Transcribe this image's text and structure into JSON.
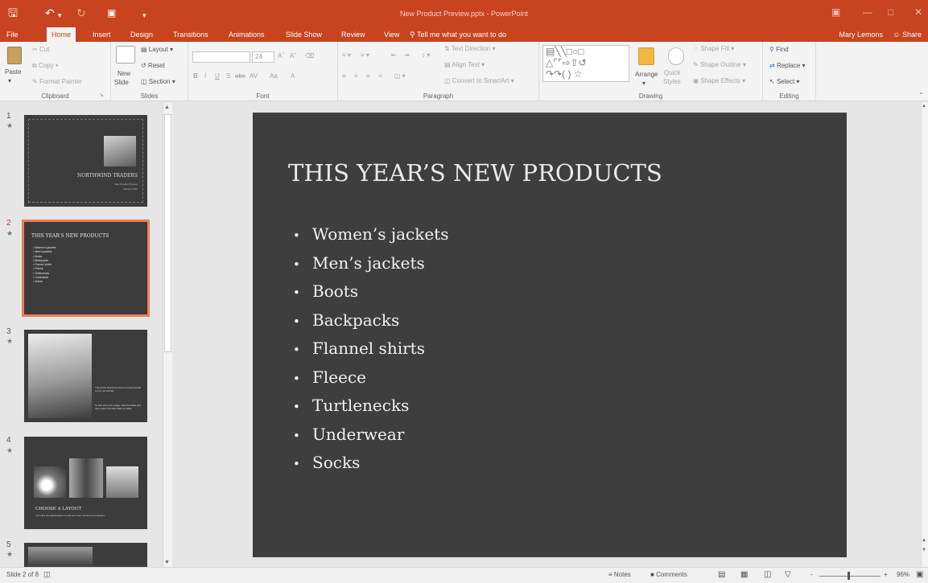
{
  "window": {
    "title": "New Product Preview.pptx - PowerPoint"
  },
  "qat": {
    "save_icon": "save-icon",
    "undo_icon": "undo-icon",
    "redo_icon": "redo-icon",
    "present_icon": "start-from-beginning-icon",
    "customize_icon": "customize-qat-icon"
  },
  "tabs": [
    "File",
    "Home",
    "Insert",
    "Design",
    "Transitions",
    "Animations",
    "Slide Show",
    "Review",
    "View"
  ],
  "active_tab": "Home",
  "tell_me": "Tell me what you want to do",
  "user": "Mary Lemons",
  "share": "Share",
  "ribbon": {
    "clipboard": {
      "label": "Clipboard",
      "paste": "Paste",
      "cut": "Cut",
      "copy": "Copy",
      "format_painter": "Format Painter"
    },
    "slides": {
      "label": "Slides",
      "new_slide_1": "New",
      "new_slide_2": "Slide",
      "layout": "Layout",
      "reset": "Reset",
      "section": "Section"
    },
    "font": {
      "label": "Font",
      "font_name": "",
      "font_size": "24",
      "bold": "B",
      "italic": "I",
      "underline": "U",
      "shadow": "S",
      "strike": "abc",
      "spacing": "AV",
      "case": "Aa",
      "color": "A"
    },
    "paragraph": {
      "label": "Paragraph",
      "text_direction": "Text Direction",
      "align_text": "Align Text",
      "convert": "Convert to SmartArt"
    },
    "drawing": {
      "label": "Drawing",
      "arrange": "Arrange",
      "quick_styles_1": "Quick",
      "quick_styles_2": "Styles",
      "shape_fill": "Shape Fill",
      "shape_outline": "Shape Outline",
      "shape_effects": "Shape Effects"
    },
    "editing": {
      "label": "Editing",
      "find": "Find",
      "replace": "Replace",
      "select": "Select"
    }
  },
  "thumbnails": [
    {
      "number": "1",
      "title": "NORTHWIND TRADERS",
      "subtitle_1": "New Product Preview",
      "subtitle_2": "January 2016"
    },
    {
      "number": "2",
      "title": "THIS YEAR'S NEW PRODUCTS",
      "items": [
        "Women's jackets",
        "Men's jackets",
        "Boots",
        "Backpacks",
        "Flannel shirts",
        "Fleece",
        "Turtlenecks",
        "Underwear",
        "Socks"
      ]
    },
    {
      "number": "3",
      "caption_1": "This photo shows someone enough people to put you started.",
      "caption_2": "To add your own image, click the Slide and then select the New Slide as Slide."
    },
    {
      "number": "4",
      "title": "CHOOSE A LAYOUT",
      "caption": "Just click the placeholders to add your own pictures and captions"
    },
    {
      "number": "5"
    }
  ],
  "slide": {
    "title": "THIS YEAR’S NEW PRODUCTS",
    "bullets": [
      "Women’s jackets",
      "Men’s jackets",
      "Boots",
      "Backpacks",
      "Flannel shirts",
      "Fleece",
      "Turtlenecks",
      "Underwear",
      "Socks"
    ]
  },
  "status": {
    "slide_info": "Slide 2 of 8",
    "notes": "Notes",
    "comments": "Comments",
    "zoom": "96%",
    "zoom_minus": "-",
    "zoom_plus": "+"
  }
}
